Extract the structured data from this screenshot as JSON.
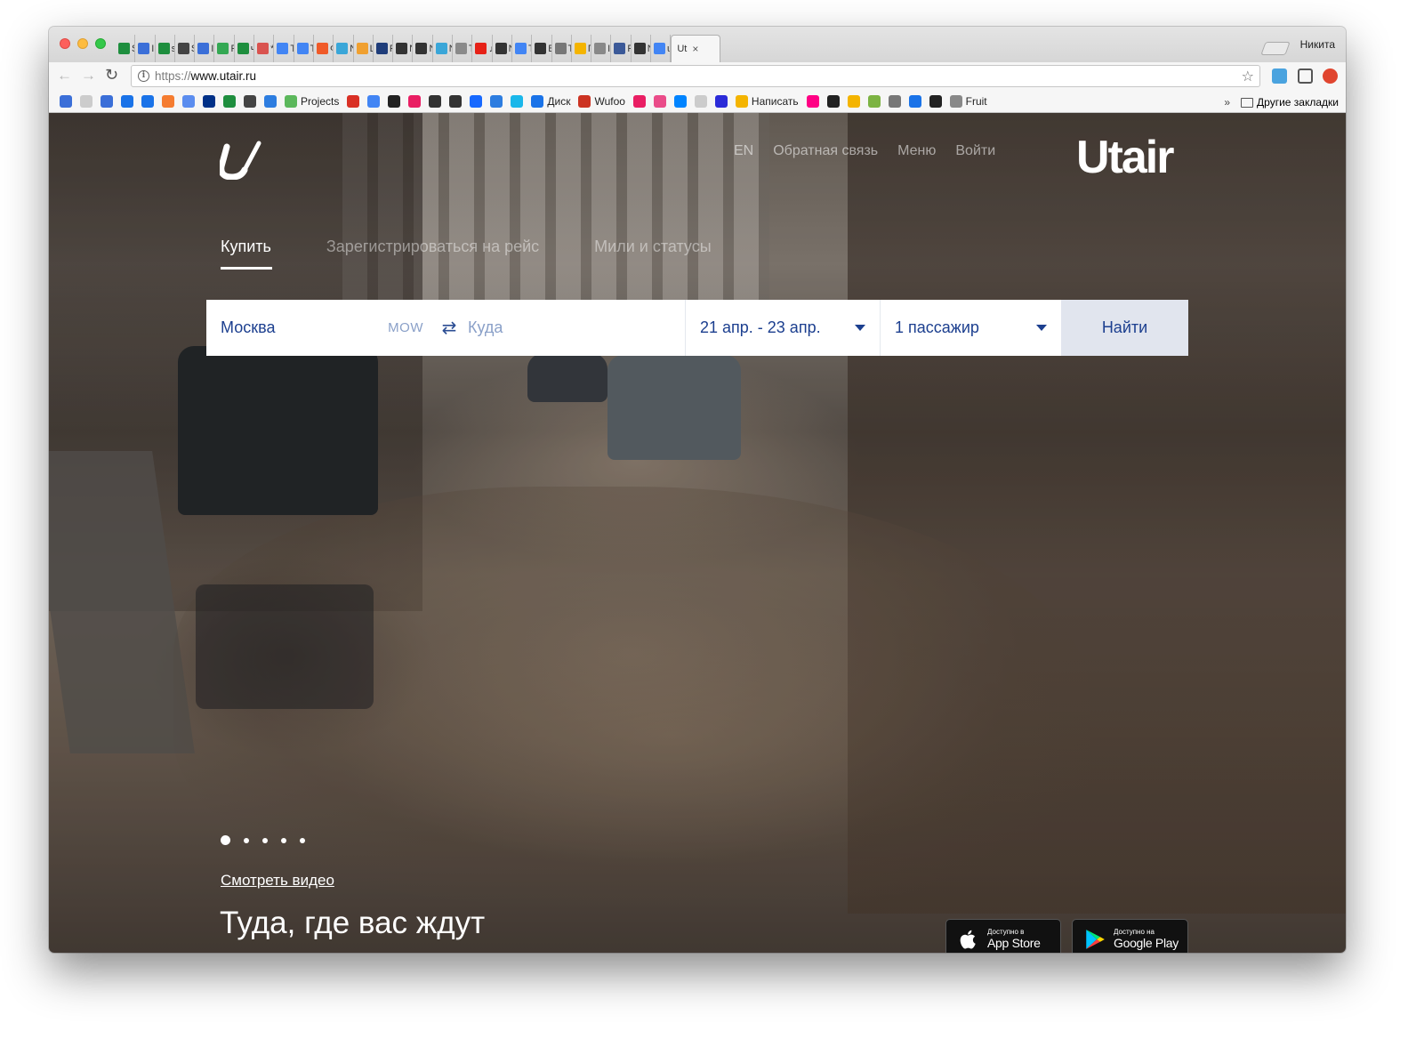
{
  "browser": {
    "profile_name": "Никита",
    "tabs": [
      {
        "label": "S",
        "color": "#1e8e3e"
      },
      {
        "label": "Ir",
        "color": "#3b6fd8"
      },
      {
        "label": "s",
        "color": "#1e8e3e"
      },
      {
        "label": "S",
        "color": "#444444"
      },
      {
        "label": "Ir",
        "color": "#3b6fd8"
      },
      {
        "label": "P",
        "color": "#34a853"
      },
      {
        "label": "ч",
        "color": "#1e8e3e"
      },
      {
        "label": "*",
        "color": "#d9534f"
      },
      {
        "label": "T",
        "color": "#4285f4"
      },
      {
        "label": "T",
        "color": "#4285f4"
      },
      {
        "label": "Ф",
        "color": "#f05a28"
      },
      {
        "label": "N",
        "color": "#3aa6d8"
      },
      {
        "label": "Ц",
        "color": "#f0a030"
      },
      {
        "label": "R",
        "color": "#1f3d7a"
      },
      {
        "label": "N",
        "color": "#333333"
      },
      {
        "label": "N",
        "color": "#333333"
      },
      {
        "label": "N",
        "color": "#3aa6d8"
      },
      {
        "label": "T",
        "color": "#8a8a8a"
      },
      {
        "label": "♫",
        "color": "#e62117"
      },
      {
        "label": "N",
        "color": "#333333"
      },
      {
        "label": "T",
        "color": "#4285f4"
      },
      {
        "label": "B",
        "color": "#333333"
      },
      {
        "label": "T",
        "color": "#777777"
      },
      {
        "label": "Г",
        "color": "#f4b400"
      },
      {
        "label": "In",
        "color": "#888888"
      },
      {
        "label": "F",
        "color": "#3b5998"
      },
      {
        "label": "N",
        "color": "#333333"
      },
      {
        "label": "u",
        "color": "#4285f4"
      }
    ],
    "active_tab": {
      "label": "Ut",
      "close": "×"
    },
    "nav": {
      "back": "←",
      "forward": "→",
      "reload": "↻"
    },
    "url": {
      "scheme": "https://",
      "host": "www.utair.ru",
      "info_glyph": "i",
      "star": "☆"
    },
    "bookmarks": [
      {
        "label": "",
        "color": "#3b6fd8"
      },
      {
        "label": "",
        "color": "#cccccc"
      },
      {
        "label": "",
        "color": "#3b6fd8"
      },
      {
        "label": "",
        "color": "#1a73e8"
      },
      {
        "label": "",
        "color": "#1a73e8"
      },
      {
        "label": "",
        "color": "#f57c30"
      },
      {
        "label": "",
        "color": "#5b8def"
      },
      {
        "label": "",
        "color": "#003087"
      },
      {
        "label": "",
        "color": "#1e8e3e"
      },
      {
        "label": "",
        "color": "#444444"
      },
      {
        "label": "",
        "color": "#2d7de0"
      },
      {
        "label": "Projects",
        "color": "#5cb85c"
      },
      {
        "label": "",
        "color": "#d93025"
      },
      {
        "label": "",
        "color": "#4285f4"
      },
      {
        "label": "",
        "color": "#222222"
      },
      {
        "label": "",
        "color": "#e91e63"
      },
      {
        "label": "",
        "color": "#333333"
      },
      {
        "label": "",
        "color": "#333333"
      },
      {
        "label": "",
        "color": "#1769ff"
      },
      {
        "label": "",
        "color": "#2d7de0"
      },
      {
        "label": "",
        "color": "#1ab7ea"
      },
      {
        "label": "Диск",
        "color": "#1a73e8"
      },
      {
        "label": "Wufoo",
        "color": "#cc3322"
      },
      {
        "label": "",
        "color": "#e91e63"
      },
      {
        "label": "",
        "color": "#ea4c89"
      },
      {
        "label": "",
        "color": "#0084ff"
      },
      {
        "label": "",
        "color": "#cccccc"
      },
      {
        "label": "",
        "color": "#2b2bd8"
      },
      {
        "label": "Написать",
        "color": "#f4b400"
      },
      {
        "label": "",
        "color": "#ff0084"
      },
      {
        "label": "",
        "color": "#222222"
      },
      {
        "label": "",
        "color": "#f4b400"
      },
      {
        "label": "",
        "color": "#7cb342"
      },
      {
        "label": "",
        "color": "#777777"
      },
      {
        "label": "",
        "color": "#1a73e8"
      },
      {
        "label": "",
        "color": "#222222"
      },
      {
        "label": "Fruit",
        "color": "#888888"
      }
    ],
    "bookmarks_more": "»",
    "other_bookmarks": "Другие закладки"
  },
  "site": {
    "brand": "Utair",
    "top_nav": {
      "lang": "EN",
      "feedback": "Обратная связь",
      "menu": "Меню",
      "login": "Войти"
    },
    "modes": [
      "Купить",
      "Зарегистрироваться на рейс",
      "Мили и статусы"
    ],
    "search": {
      "from_city": "Москва",
      "from_code": "MOW",
      "swap_glyph": "⇄",
      "to_placeholder": "Куда",
      "dates": "21 апр. - 23 апр.",
      "passengers": "1 пассажир",
      "find_button": "Найти"
    },
    "carousel": {
      "total": 5,
      "active": 0
    },
    "video_link": "Смотреть видео",
    "tagline": "Туда, где вас ждут",
    "stores": {
      "apple": {
        "small": "Доступно в",
        "big": "App Store"
      },
      "google": {
        "small": "Доступно на",
        "big": "Google Play"
      }
    }
  }
}
